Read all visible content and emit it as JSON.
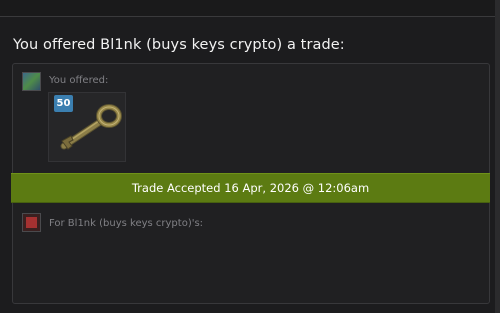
{
  "trade": {
    "title": "You offered Bl1nk (buys keys crypto) a trade:",
    "you_offered_label": "You offered:",
    "for_label": "For Bl1nk (buys keys crypto)'s:",
    "item": {
      "quantity": "50",
      "icon": "key-icon"
    },
    "status_banner": "Trade Accepted 16 Apr, 2026 @ 12:06am"
  },
  "colors": {
    "background": "#1c1c1e",
    "panel": "#202022",
    "banner": "#5c7b12",
    "quantity_badge": "#3b7fb0"
  }
}
